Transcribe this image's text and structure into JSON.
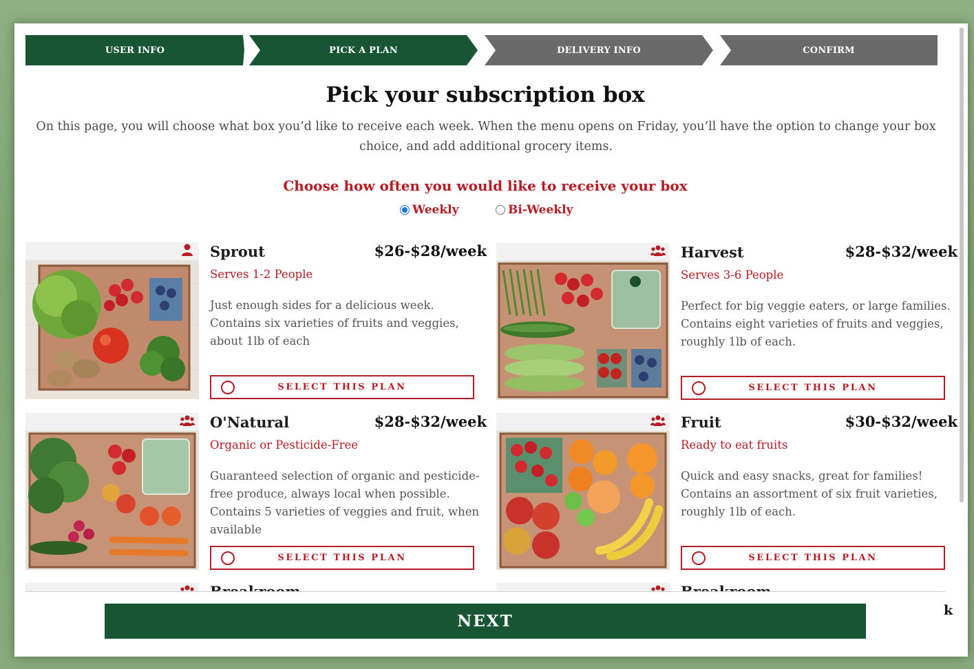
{
  "steps": [
    {
      "label": "USER INFO",
      "status": "completed"
    },
    {
      "label": "PICK A PLAN",
      "status": "current"
    },
    {
      "label": "DELIVERY INFO",
      "status": "upcoming"
    },
    {
      "label": "CONFIRM",
      "status": "upcoming"
    }
  ],
  "page": {
    "title": "Pick your subscription box",
    "intro": "On this page, you will choose what box you’d like to receive each week. When the menu opens on Friday, you’ll have the option to change your box choice, and add additional grocery items."
  },
  "frequency": {
    "heading": "Choose how often you would like to receive your box",
    "options": [
      {
        "label": "Weekly",
        "selected": true
      },
      {
        "label": "Bi-Weekly",
        "selected": false
      }
    ]
  },
  "plans": [
    {
      "name": "Sprout",
      "price": "$26-$28/week",
      "serves": "Serves 1-2 People",
      "description": "Just enough sides for a delicious week. Contains six varieties of fruits and veggies, about 1lb of each",
      "button": "SELECT THIS PLAN",
      "icon": "person-icon"
    },
    {
      "name": "Harvest",
      "price": "$28-$32/week",
      "serves": "Serves 3-6 People",
      "description": "Perfect for big veggie eaters, or large families. Contains eight varieties of fruits and veggies, roughly 1lb of each.",
      "button": "SELECT THIS PLAN",
      "icon": "group-icon"
    },
    {
      "name": "O'Natural",
      "price": "$28-$32/week",
      "serves": "Organic or Pesticide-Free",
      "description": "Guaranteed selection of organic and pesticide-free produce, always local when possible. Contains 5 varieties of veggies and fruit, when available",
      "button": "SELECT THIS PLAN",
      "icon": "group-icon"
    },
    {
      "name": "Fruit",
      "price": "$30-$32/week",
      "serves": "Ready to eat fruits",
      "description": "Quick and easy snacks, great for families! Contains an assortment of six fruit varieties, roughly 1lb of each.",
      "button": "SELECT THIS PLAN",
      "icon": "group-icon"
    }
  ],
  "partial_plans": [
    {
      "name": "Breakroom"
    },
    {
      "name": "Breakroom"
    }
  ],
  "footer": {
    "next_label": "NEXT",
    "stray_text": "k"
  },
  "colors": {
    "green": "#175533",
    "gray": "#6a6a6a",
    "red": "#b51c24"
  }
}
